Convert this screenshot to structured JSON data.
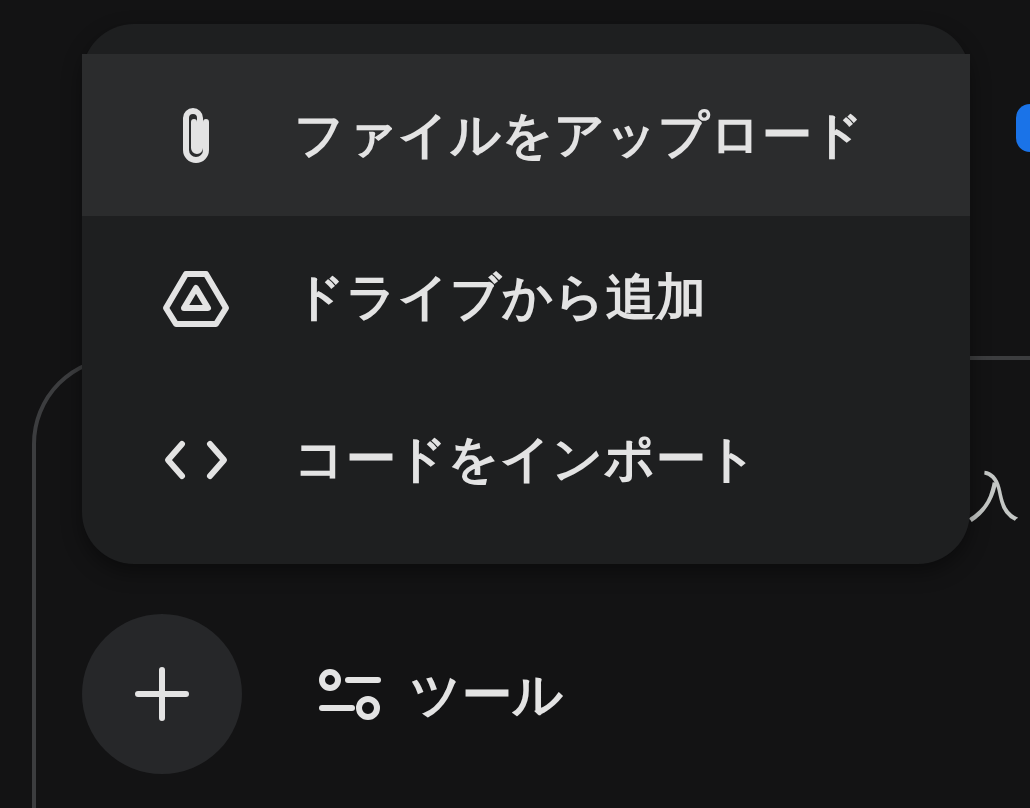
{
  "menu": {
    "items": [
      {
        "label": "ファイルをアップロード",
        "kind": "paperclip",
        "selected": true
      },
      {
        "label": "ドライブから追加",
        "kind": "drive",
        "selected": false
      },
      {
        "label": "コードをインポート",
        "kind": "code",
        "selected": false
      }
    ]
  },
  "input": {
    "placeholder": "入"
  },
  "toolbar": {
    "tools_label": "ツール"
  }
}
